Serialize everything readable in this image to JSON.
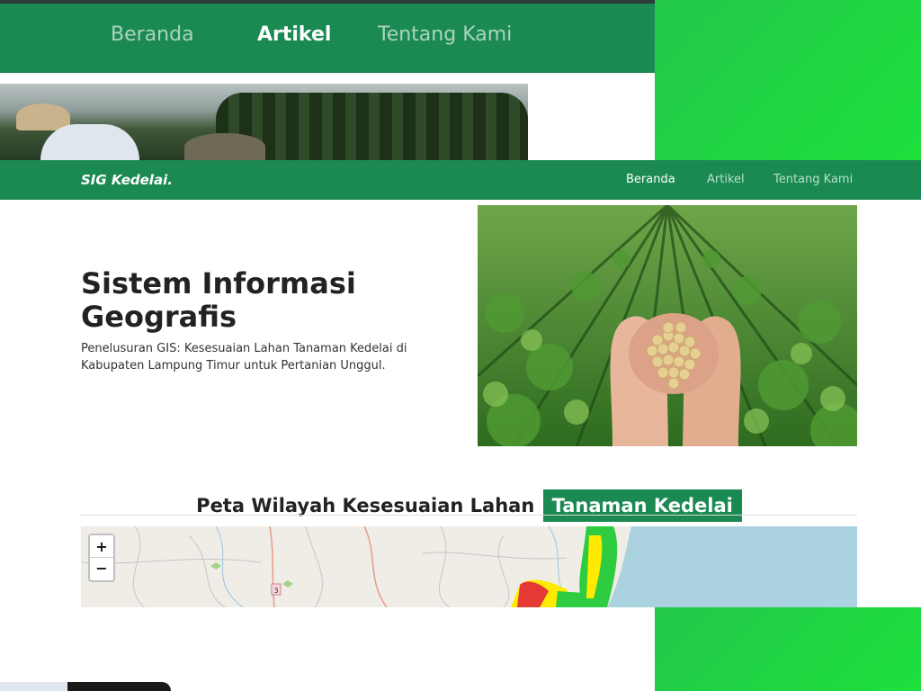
{
  "background_nav": {
    "items": [
      "Beranda",
      "Artikel",
      "Tentang Kami"
    ],
    "active": "Artikel"
  },
  "navbar": {
    "brand": "SIG Kedelai.",
    "items": [
      "Beranda",
      "Artikel",
      "Tentang Kami"
    ],
    "active": "Beranda"
  },
  "hero": {
    "title": "Sistem Informasi Geografis",
    "subtitle": "Penelusuran GIS: Kesesuaian Lahan Tanaman Kedelai di Kabupaten Lampung Timur untuk Pertanian Unggul."
  },
  "map_section": {
    "title_plain": "Peta Wilayah Kesesuaian Lahan",
    "title_highlight": "Tanaman Kedelai",
    "zoom_in": "+",
    "zoom_out": "−",
    "route_label": "3"
  },
  "colors": {
    "primary": "#1b8a52",
    "accent_green": "#1ee03c",
    "sea": "#aad3df"
  }
}
